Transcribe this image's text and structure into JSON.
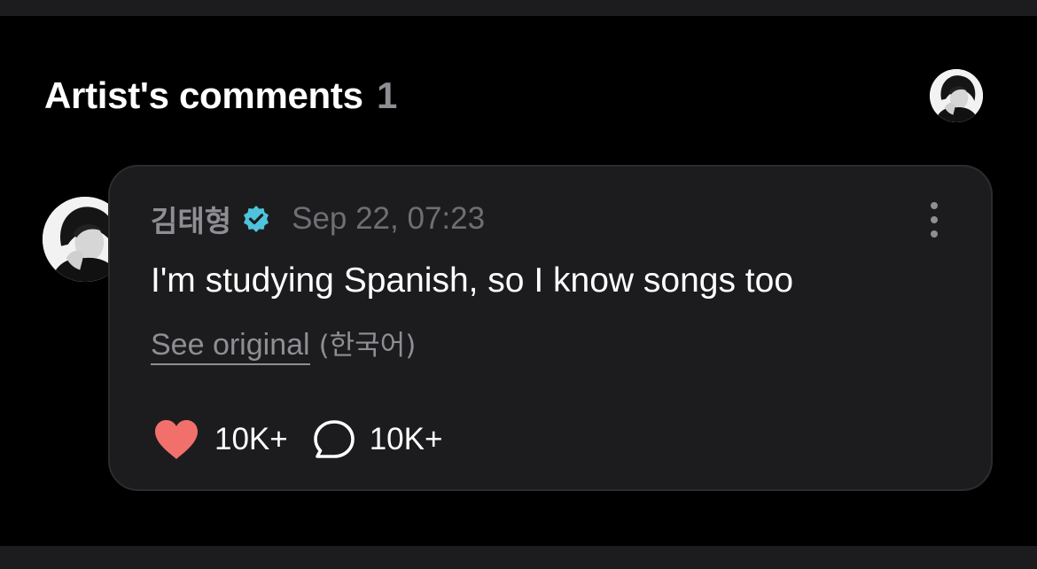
{
  "header": {
    "title": "Artist's comments",
    "count": "1"
  },
  "top_avatar": {
    "icon": "artist-profile-photo"
  },
  "comment": {
    "avatar_icon": "artist-profile-photo",
    "author": "김태형",
    "verified_icon": "verified-badge-icon",
    "timestamp": "Sep 22, 07:23",
    "more_icon": "more-vertical-icon",
    "text": "I'm studying Spanish, so I know songs too",
    "see_original_label": "See original",
    "original_language": "(한국어)",
    "likes": {
      "icon": "heart-icon",
      "count": "10K+"
    },
    "replies": {
      "icon": "comment-bubble-icon",
      "count": "10K+"
    }
  },
  "colors": {
    "background": "#000000",
    "card": "#1c1c1e",
    "card_border": "#2c2c2e",
    "muted_text": "#8e8e93",
    "timestamp": "#6e6e73",
    "heart": "#f2706b",
    "verified": "#4fc3dc"
  }
}
